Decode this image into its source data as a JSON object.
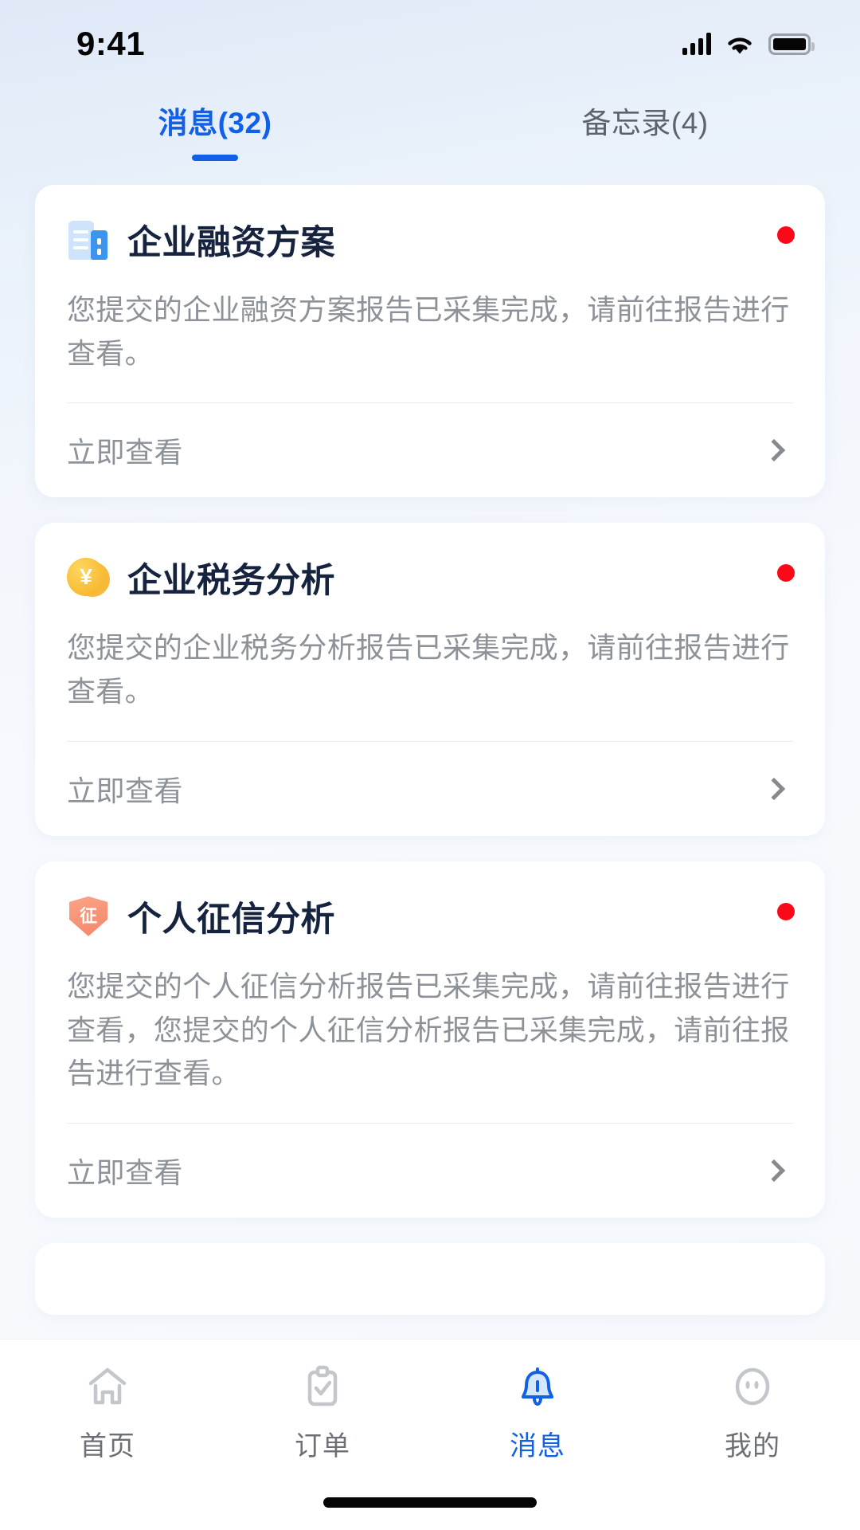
{
  "status_bar": {
    "time": "9:41",
    "signal_icon": "cellular-signal-icon",
    "wifi_icon": "wifi-icon",
    "battery_icon": "battery-full-icon"
  },
  "tabs": {
    "items": [
      {
        "label": "消息(32)",
        "active": true,
        "name": "tab-messages"
      },
      {
        "label": "备忘录(4)",
        "active": false,
        "name": "tab-memos"
      }
    ],
    "active_color": "#1160e8",
    "inactive_color": "#5f6369"
  },
  "cards": [
    {
      "icon": "building-icon",
      "title": "企业融资方案",
      "body": "您提交的企业融资方案报告已采集完成，请前往报告进行查看。",
      "action_label": "立即查看",
      "unread": true,
      "unread_color": "#fa0a18",
      "chevron_icon": "chevron-right-icon"
    },
    {
      "icon": "coin-yen-icon",
      "icon_glyph": "¥",
      "title": "企业税务分析",
      "body": "您提交的企业税务分析报告已采集完成，请前往报告进行查看。",
      "action_label": "立即查看",
      "unread": true,
      "unread_color": "#fa0a18",
      "chevron_icon": "chevron-right-icon"
    },
    {
      "icon": "shield-credit-icon",
      "icon_glyph": "征",
      "title": "个人征信分析",
      "body": "您提交的个人征信分析报告已采集完成，请前往报告进行查看，您提交的个人征信分析报告已采集完成，请前往报告进行查看。",
      "action_label": "立即查看",
      "unread": true,
      "unread_color": "#fa0a18",
      "chevron_icon": "chevron-right-icon"
    }
  ],
  "bottom_nav": {
    "items": [
      {
        "label": "首页",
        "icon": "home-icon",
        "active": false,
        "name": "nav-home"
      },
      {
        "label": "订单",
        "icon": "clipboard-check-icon",
        "active": false,
        "name": "nav-orders"
      },
      {
        "label": "消息",
        "icon": "bell-icon",
        "active": true,
        "name": "nav-messages"
      },
      {
        "label": "我的",
        "icon": "user-icon",
        "active": false,
        "name": "nav-profile"
      }
    ],
    "active_color": "#1160e8",
    "inactive_color": "#6c7076"
  }
}
